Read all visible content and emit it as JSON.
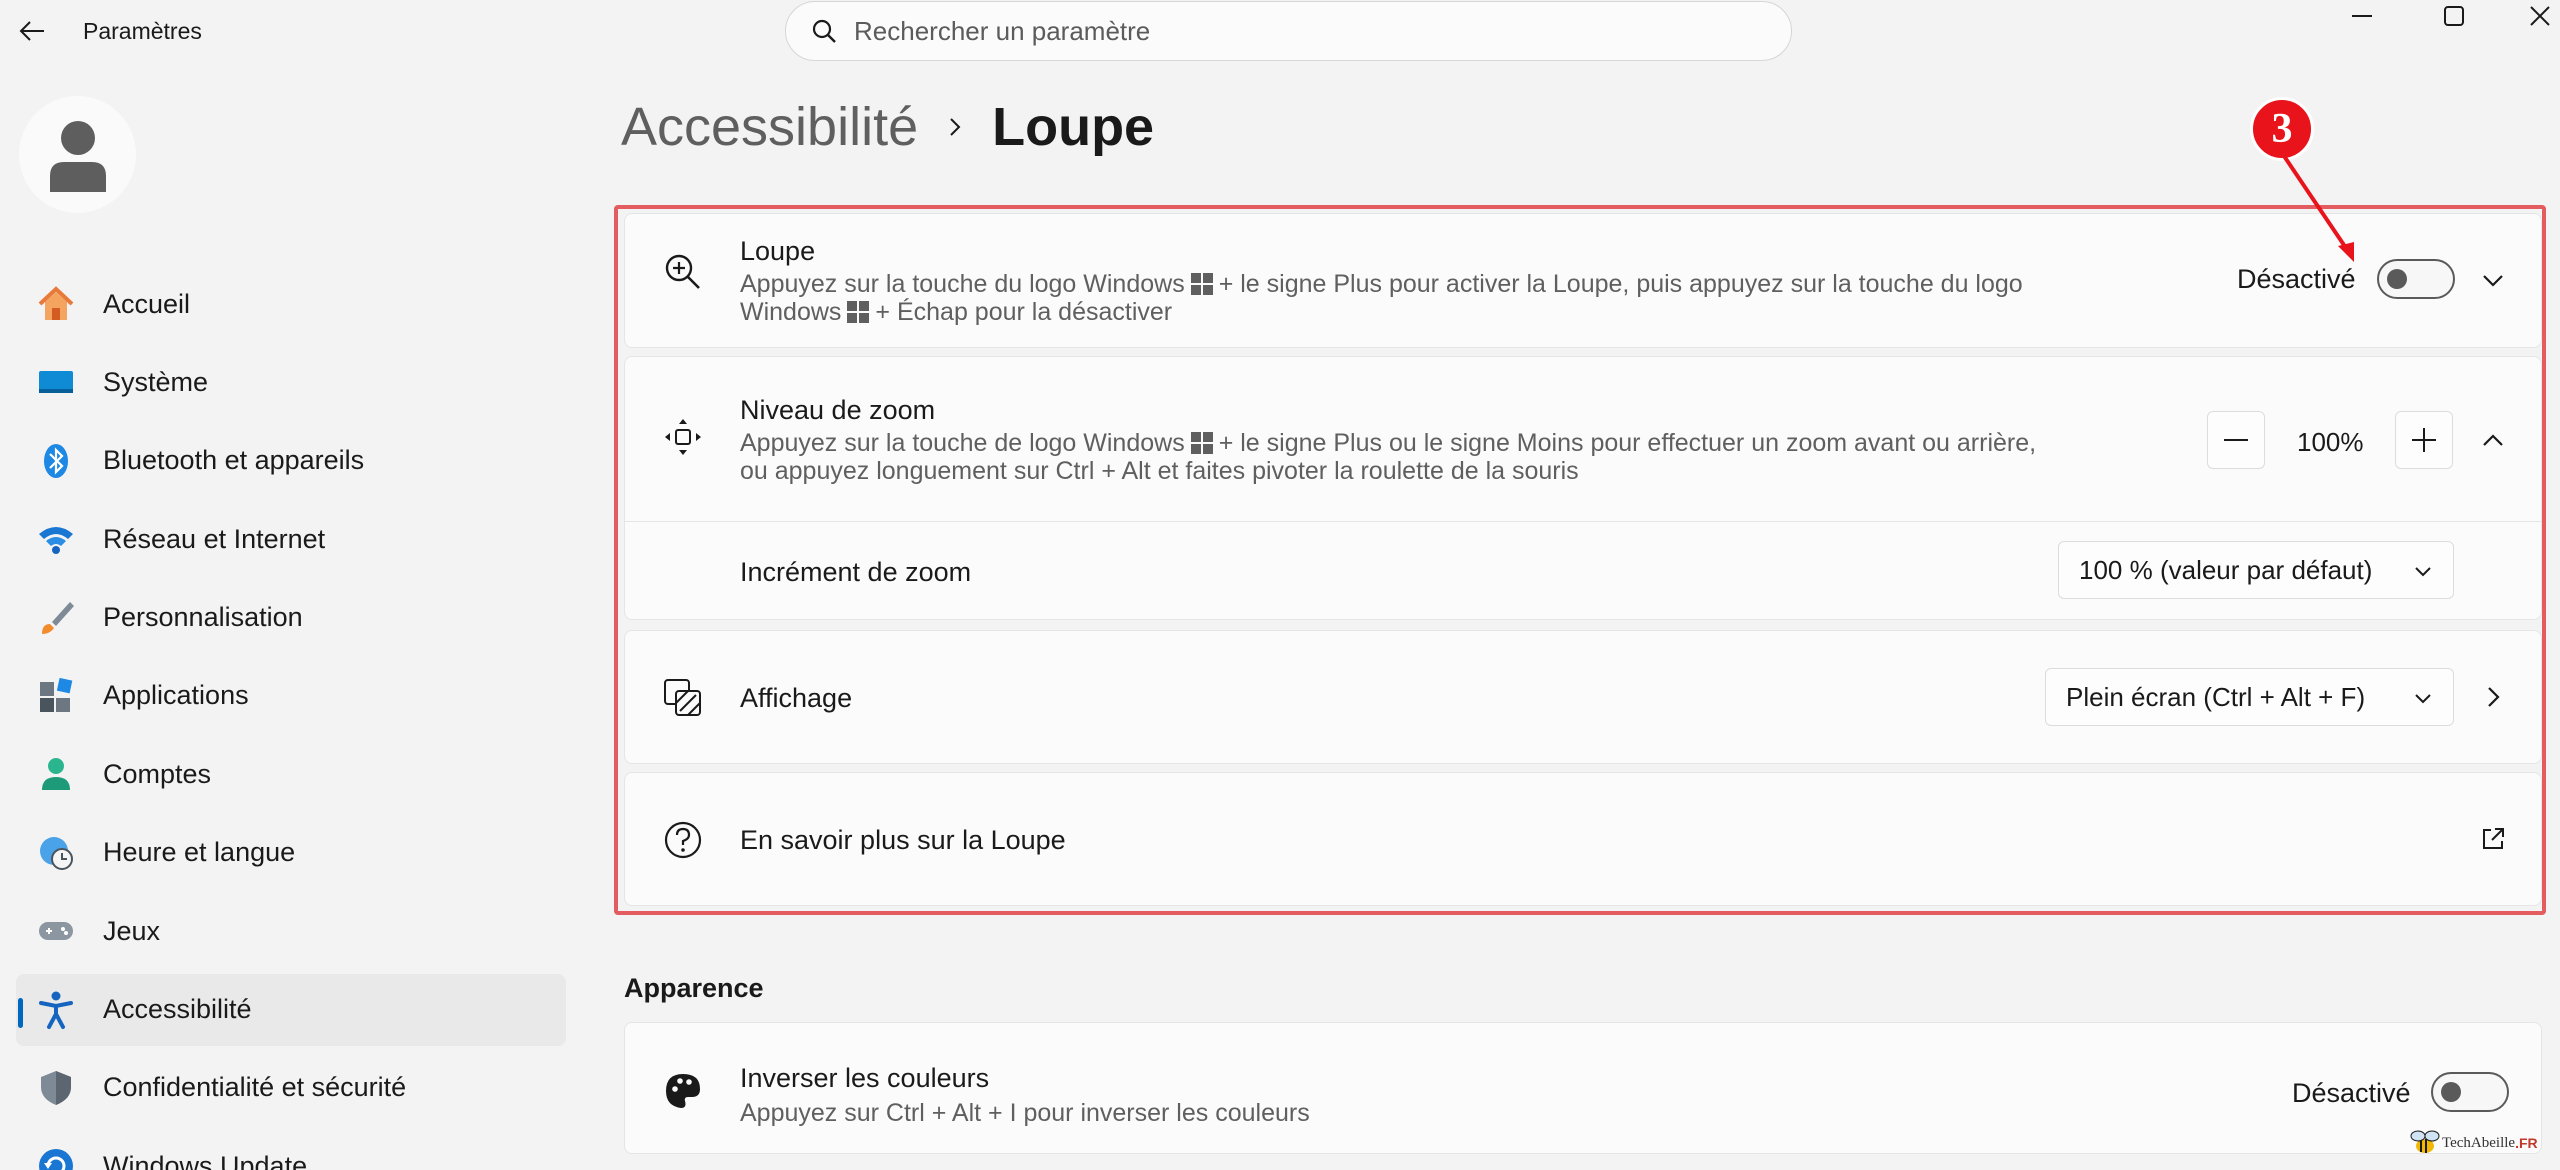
{
  "window": {
    "app_title": "Paramètres",
    "search_placeholder": "Rechercher un paramètre"
  },
  "sidebar": {
    "items": [
      {
        "label": "Accueil",
        "icon": "home-icon"
      },
      {
        "label": "Système",
        "icon": "system-icon"
      },
      {
        "label": "Bluetooth et appareils",
        "icon": "bluetooth-icon"
      },
      {
        "label": "Réseau et Internet",
        "icon": "wifi-icon"
      },
      {
        "label": "Personnalisation",
        "icon": "brush-icon"
      },
      {
        "label": "Applications",
        "icon": "apps-icon"
      },
      {
        "label": "Comptes",
        "icon": "account-icon"
      },
      {
        "label": "Heure et langue",
        "icon": "clock-globe-icon"
      },
      {
        "label": "Jeux",
        "icon": "gamepad-icon"
      },
      {
        "label": "Accessibilité",
        "icon": "accessibility-icon",
        "active": true
      },
      {
        "label": "Confidentialité et sécurité",
        "icon": "shield-icon"
      },
      {
        "label": "Windows Update",
        "icon": "update-icon"
      }
    ]
  },
  "breadcrumb": {
    "parent": "Accessibilité",
    "current": "Loupe"
  },
  "magnifier": {
    "title": "Loupe",
    "desc_line1_a": "Appuyez sur la touche du logo Windows",
    "desc_line1_b": "+ le signe Plus pour activer la Loupe, puis appuyez sur la touche du logo",
    "desc_line2_a": "Windows",
    "desc_line2_b": "+ Échap pour la désactiver",
    "state_label": "Désactivé",
    "toggle_on": false
  },
  "zoom_level": {
    "title": "Niveau de zoom",
    "desc_line1_a": "Appuyez sur la touche de logo Windows",
    "desc_line1_b": "+ le signe Plus ou le signe Moins pour effectuer un zoom avant ou arrière,",
    "desc_line2": "ou appuyez longuement sur Ctrl + Alt et faites pivoter la roulette de la souris",
    "value": "100%"
  },
  "zoom_increment": {
    "title": "Incrément de zoom",
    "selected": "100 % (valeur par défaut)"
  },
  "view": {
    "title": "Affichage",
    "selected": "Plein écran (Ctrl + Alt + F)"
  },
  "learn_more": {
    "title": "En savoir plus sur la Loupe"
  },
  "annotation": {
    "step": "3",
    "color": "#e8131b",
    "box_color": "#e35c60"
  },
  "appearance": {
    "section_title": "Apparence",
    "invert": {
      "title": "Inverser les couleurs",
      "desc": "Appuyez sur Ctrl + Alt + I pour inverser les couleurs",
      "state_label": "Désactivé",
      "toggle_on": false
    }
  },
  "watermark": {
    "text": "TechAbeille",
    "suffix": ".FR"
  },
  "colors": {
    "accent": "#0067c0",
    "background": "#f3f3f3",
    "card": "#fbfbfb"
  }
}
